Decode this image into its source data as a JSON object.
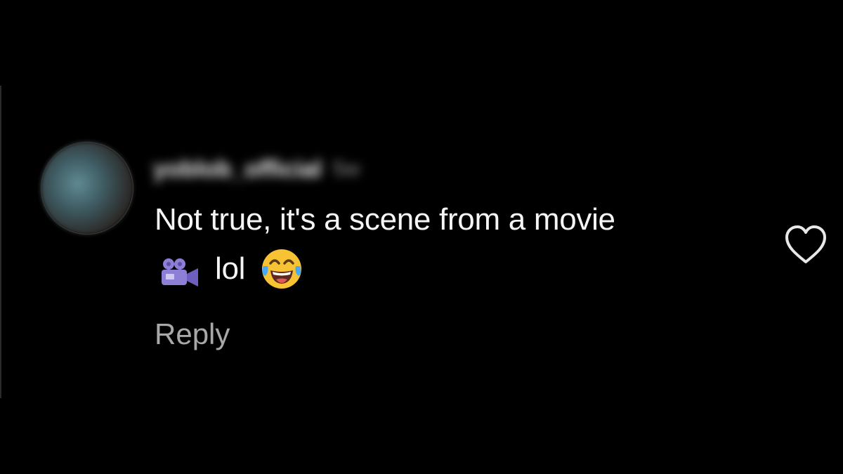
{
  "comment": {
    "username": "yoblob_official",
    "timestamp": "5w",
    "text_line1": "Not true, it's a scene from a movie",
    "text_word": "lol",
    "icons": [
      "movie-camera-icon",
      "face-with-tears-of-joy-icon",
      "heart-outline-icon"
    ],
    "reply_label": "Reply"
  },
  "colors": {
    "background": "#000000",
    "text": "#f5f5f5",
    "secondary_text": "#a8a8a8"
  }
}
